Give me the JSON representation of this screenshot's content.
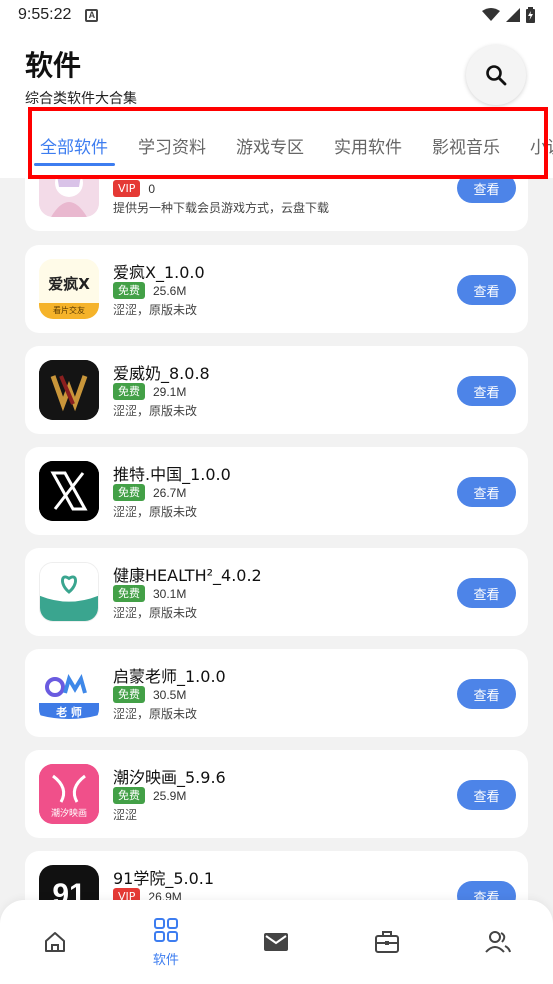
{
  "status": {
    "time": "9:55:22",
    "a_label": "A"
  },
  "header": {
    "title": "软件",
    "subtitle": "综合类软件大合集"
  },
  "tabs": [
    "全部软件",
    "学习资料",
    "游戏专区",
    "实用软件",
    "影视音乐",
    "小说"
  ],
  "active_tab": 0,
  "apps": [
    {
      "name": "",
      "badge": "VIP",
      "badge_color": "#e53935",
      "size": "0",
      "desc": "提供另一种下载会员游戏方式，云盘下载",
      "button": "查看"
    },
    {
      "name": "爱疯X_1.0.0",
      "badge": "免费",
      "badge_color": "#43a047",
      "size": "25.6M",
      "desc": "涩涩，原版未改",
      "button": "查看"
    },
    {
      "name": "爱威奶_8.0.8",
      "badge": "免费",
      "badge_color": "#43a047",
      "size": "29.1M",
      "desc": "涩涩，原版未改",
      "button": "查看"
    },
    {
      "name": "推特.中国_1.0.0",
      "badge": "免费",
      "badge_color": "#43a047",
      "size": "26.7M",
      "desc": "涩涩，原版未改",
      "button": "查看"
    },
    {
      "name": "健康HEALTH²_4.0.2",
      "badge": "免费",
      "badge_color": "#43a047",
      "size": "30.1M",
      "desc": "涩涩，原版未改",
      "button": "查看"
    },
    {
      "name": "启蒙老师_1.0.0",
      "badge": "免费",
      "badge_color": "#43a047",
      "size": "30.5M",
      "desc": "涩涩，原版未改",
      "button": "查看"
    },
    {
      "name": "潮汐映画_5.9.6",
      "badge": "免费",
      "badge_color": "#43a047",
      "size": "25.9M",
      "desc": "涩涩",
      "button": "查看"
    },
    {
      "name": "91学院_5.0.1",
      "badge": "VIP",
      "badge_color": "#e53935",
      "size": "26.9M",
      "desc": "",
      "button": "查看"
    }
  ],
  "icons": {
    "aifeng": "爱疯X",
    "aifeng_sub": "看片交友",
    "laoshi": "老 师",
    "chaoxi": "潮汐映画",
    "xue91": "91"
  },
  "nav": {
    "active_label": "软件"
  },
  "colors": {
    "accent": "#3d7df0",
    "highlight": "#ff0000"
  }
}
